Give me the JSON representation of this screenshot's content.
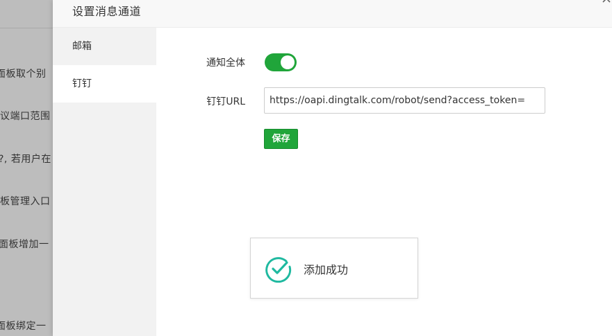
{
  "background": {
    "rows": [
      "面板取个别",
      "议端口范围",
      "?, 若用户在",
      "板管理入口",
      "面板增加一",
      "面板绑定一"
    ]
  },
  "modal": {
    "title": "设置消息通道",
    "close_icon": "close-icon",
    "menu": [
      {
        "label": "邮箱",
        "active": false
      },
      {
        "label": "钉钉",
        "active": true
      }
    ]
  },
  "form": {
    "notify_all_label": "通知全体",
    "notify_all_on": true,
    "url_label": "钉钉URL",
    "url_value": "https://oapi.dingtalk.com/robot/send?access_token=",
    "save_label": "保存"
  },
  "toast": {
    "icon": "check-circle-icon",
    "message": "添加成功"
  },
  "colors": {
    "accent": "#20a53a",
    "success_icon": "#1fb9a0"
  }
}
